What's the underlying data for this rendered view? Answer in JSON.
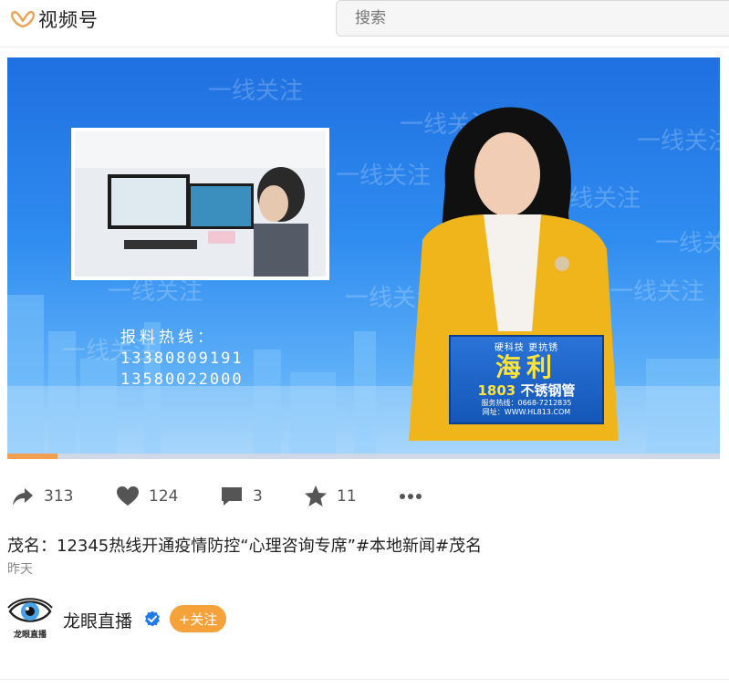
{
  "app": {
    "name": "视频号"
  },
  "search": {
    "placeholder": "搜索"
  },
  "video": {
    "watermark": "一线关注",
    "hotline_title": "报料热线：",
    "hotline_numbers": [
      "13380809191",
      "13580022000"
    ],
    "desk_sign": {
      "slogan": "硬科技 更抗锈",
      "brand": "海利",
      "product_number": "1803",
      "product_name": "不锈钢管",
      "service_line": "服务热线：0668-7212835",
      "website": "网址：WWW.HL813.COM"
    },
    "progress_fraction": 0.07
  },
  "actions": {
    "share": {
      "icon": "share-icon",
      "count": "313"
    },
    "like": {
      "icon": "heart-icon",
      "count": "124"
    },
    "comment": {
      "icon": "comment-icon",
      "count": "3"
    },
    "favorite": {
      "icon": "star-icon",
      "count": "11"
    },
    "more": {
      "icon": "more-icon"
    }
  },
  "post": {
    "title": "茂名：12345热线开通疫情防控“心理咨询专席”#本地新闻#茂名",
    "date": "昨天"
  },
  "author": {
    "name": "龙眼直播",
    "avatar_label": "龙眼直播",
    "follow_label": "+关注"
  },
  "colors": {
    "accent": "#f6a23b",
    "logo": "#f0a050",
    "verified": "#1f7ae8"
  }
}
